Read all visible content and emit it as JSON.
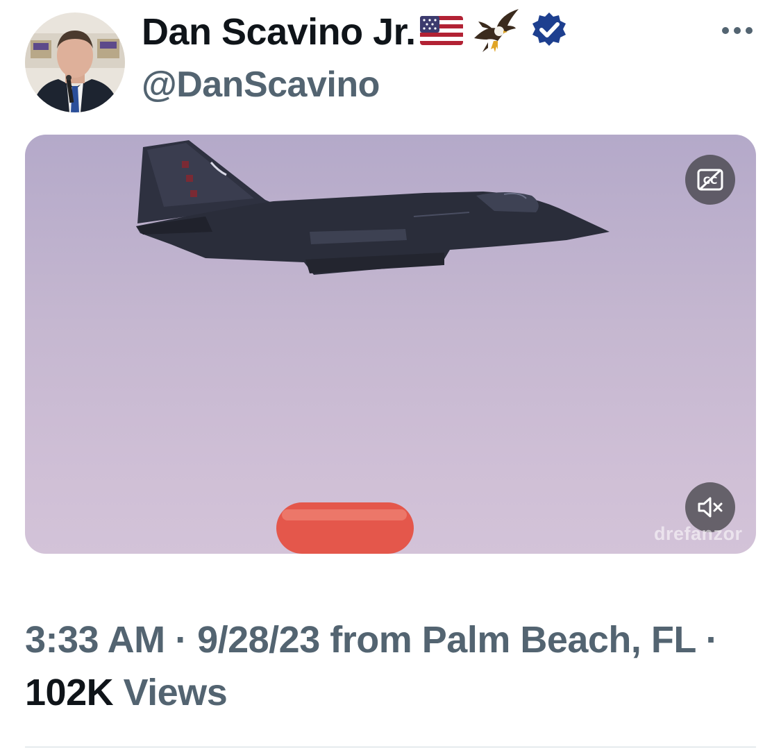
{
  "author": {
    "display_name": "Dan Scavino Jr.",
    "handle": "@DanScavino",
    "name_emojis": [
      "us-flag-icon",
      "eagle-icon"
    ],
    "verified": true,
    "verified_color": "#1d3f8f"
  },
  "media": {
    "type": "video",
    "watermark": "drefanzor",
    "captions_button_label": "CC",
    "muted": true
  },
  "meta": {
    "time": "3:33 AM",
    "separator": "·",
    "date": "9/28/23",
    "source": "from Palm Beach, FL",
    "views_count": "102K",
    "views_label": "Views"
  },
  "colors": {
    "primary_text": "#0f1419",
    "secondary_text": "#536471",
    "divider": "#cfd9de"
  }
}
